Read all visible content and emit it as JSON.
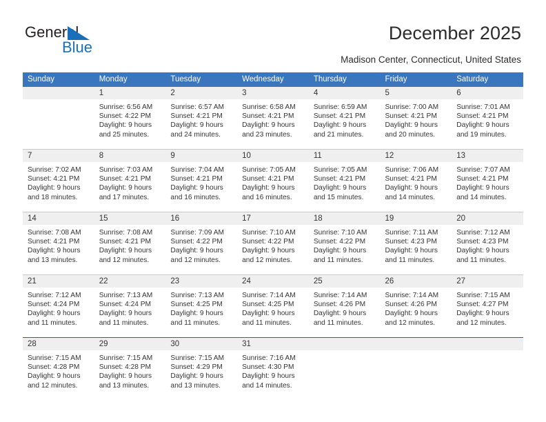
{
  "brand": {
    "name_top": "General",
    "name_bottom": "Blue",
    "triangle_icon": "triangle-icon",
    "color_dark": "#231f20",
    "color_blue": "#1b6fba"
  },
  "header": {
    "title": "December 2025",
    "subtitle": "Madison Center, Connecticut, United States"
  },
  "theme": {
    "header_bg": "#3a76bd",
    "daynum_bg": "#efefef",
    "grid_line": "#c8c8c8",
    "accent_line": "#1f63a8",
    "text": "#333333"
  },
  "calendar": {
    "weekday_headers": [
      "Sunday",
      "Monday",
      "Tuesday",
      "Wednesday",
      "Thursday",
      "Friday",
      "Saturday"
    ],
    "weeks": [
      [
        {
          "day": "",
          "lines": []
        },
        {
          "day": "1",
          "lines": [
            "Sunrise: 6:56 AM",
            "Sunset: 4:22 PM",
            "Daylight: 9 hours",
            "and 25 minutes."
          ]
        },
        {
          "day": "2",
          "lines": [
            "Sunrise: 6:57 AM",
            "Sunset: 4:21 PM",
            "Daylight: 9 hours",
            "and 24 minutes."
          ]
        },
        {
          "day": "3",
          "lines": [
            "Sunrise: 6:58 AM",
            "Sunset: 4:21 PM",
            "Daylight: 9 hours",
            "and 23 minutes."
          ]
        },
        {
          "day": "4",
          "lines": [
            "Sunrise: 6:59 AM",
            "Sunset: 4:21 PM",
            "Daylight: 9 hours",
            "and 21 minutes."
          ]
        },
        {
          "day": "5",
          "lines": [
            "Sunrise: 7:00 AM",
            "Sunset: 4:21 PM",
            "Daylight: 9 hours",
            "and 20 minutes."
          ]
        },
        {
          "day": "6",
          "lines": [
            "Sunrise: 7:01 AM",
            "Sunset: 4:21 PM",
            "Daylight: 9 hours",
            "and 19 minutes."
          ]
        }
      ],
      [
        {
          "day": "7",
          "lines": [
            "Sunrise: 7:02 AM",
            "Sunset: 4:21 PM",
            "Daylight: 9 hours",
            "and 18 minutes."
          ]
        },
        {
          "day": "8",
          "lines": [
            "Sunrise: 7:03 AM",
            "Sunset: 4:21 PM",
            "Daylight: 9 hours",
            "and 17 minutes."
          ]
        },
        {
          "day": "9",
          "lines": [
            "Sunrise: 7:04 AM",
            "Sunset: 4:21 PM",
            "Daylight: 9 hours",
            "and 16 minutes."
          ]
        },
        {
          "day": "10",
          "lines": [
            "Sunrise: 7:05 AM",
            "Sunset: 4:21 PM",
            "Daylight: 9 hours",
            "and 16 minutes."
          ]
        },
        {
          "day": "11",
          "lines": [
            "Sunrise: 7:05 AM",
            "Sunset: 4:21 PM",
            "Daylight: 9 hours",
            "and 15 minutes."
          ]
        },
        {
          "day": "12",
          "lines": [
            "Sunrise: 7:06 AM",
            "Sunset: 4:21 PM",
            "Daylight: 9 hours",
            "and 14 minutes."
          ]
        },
        {
          "day": "13",
          "lines": [
            "Sunrise: 7:07 AM",
            "Sunset: 4:21 PM",
            "Daylight: 9 hours",
            "and 14 minutes."
          ]
        }
      ],
      [
        {
          "day": "14",
          "lines": [
            "Sunrise: 7:08 AM",
            "Sunset: 4:21 PM",
            "Daylight: 9 hours",
            "and 13 minutes."
          ]
        },
        {
          "day": "15",
          "lines": [
            "Sunrise: 7:08 AM",
            "Sunset: 4:21 PM",
            "Daylight: 9 hours",
            "and 12 minutes."
          ]
        },
        {
          "day": "16",
          "lines": [
            "Sunrise: 7:09 AM",
            "Sunset: 4:22 PM",
            "Daylight: 9 hours",
            "and 12 minutes."
          ]
        },
        {
          "day": "17",
          "lines": [
            "Sunrise: 7:10 AM",
            "Sunset: 4:22 PM",
            "Daylight: 9 hours",
            "and 12 minutes."
          ]
        },
        {
          "day": "18",
          "lines": [
            "Sunrise: 7:10 AM",
            "Sunset: 4:22 PM",
            "Daylight: 9 hours",
            "and 11 minutes."
          ]
        },
        {
          "day": "19",
          "lines": [
            "Sunrise: 7:11 AM",
            "Sunset: 4:23 PM",
            "Daylight: 9 hours",
            "and 11 minutes."
          ]
        },
        {
          "day": "20",
          "lines": [
            "Sunrise: 7:12 AM",
            "Sunset: 4:23 PM",
            "Daylight: 9 hours",
            "and 11 minutes."
          ]
        }
      ],
      [
        {
          "day": "21",
          "lines": [
            "Sunrise: 7:12 AM",
            "Sunset: 4:24 PM",
            "Daylight: 9 hours",
            "and 11 minutes."
          ]
        },
        {
          "day": "22",
          "lines": [
            "Sunrise: 7:13 AM",
            "Sunset: 4:24 PM",
            "Daylight: 9 hours",
            "and 11 minutes."
          ]
        },
        {
          "day": "23",
          "lines": [
            "Sunrise: 7:13 AM",
            "Sunset: 4:25 PM",
            "Daylight: 9 hours",
            "and 11 minutes."
          ]
        },
        {
          "day": "24",
          "lines": [
            "Sunrise: 7:14 AM",
            "Sunset: 4:25 PM",
            "Daylight: 9 hours",
            "and 11 minutes."
          ]
        },
        {
          "day": "25",
          "lines": [
            "Sunrise: 7:14 AM",
            "Sunset: 4:26 PM",
            "Daylight: 9 hours",
            "and 11 minutes."
          ]
        },
        {
          "day": "26",
          "lines": [
            "Sunrise: 7:14 AM",
            "Sunset: 4:26 PM",
            "Daylight: 9 hours",
            "and 12 minutes."
          ]
        },
        {
          "day": "27",
          "lines": [
            "Sunrise: 7:15 AM",
            "Sunset: 4:27 PM",
            "Daylight: 9 hours",
            "and 12 minutes."
          ]
        }
      ],
      [
        {
          "day": "28",
          "lines": [
            "Sunrise: 7:15 AM",
            "Sunset: 4:28 PM",
            "Daylight: 9 hours",
            "and 12 minutes."
          ]
        },
        {
          "day": "29",
          "lines": [
            "Sunrise: 7:15 AM",
            "Sunset: 4:28 PM",
            "Daylight: 9 hours",
            "and 13 minutes."
          ]
        },
        {
          "day": "30",
          "lines": [
            "Sunrise: 7:15 AM",
            "Sunset: 4:29 PM",
            "Daylight: 9 hours",
            "and 13 minutes."
          ]
        },
        {
          "day": "31",
          "lines": [
            "Sunrise: 7:16 AM",
            "Sunset: 4:30 PM",
            "Daylight: 9 hours",
            "and 14 minutes."
          ]
        },
        {
          "day": "",
          "lines": []
        },
        {
          "day": "",
          "lines": []
        },
        {
          "day": "",
          "lines": []
        }
      ]
    ]
  }
}
